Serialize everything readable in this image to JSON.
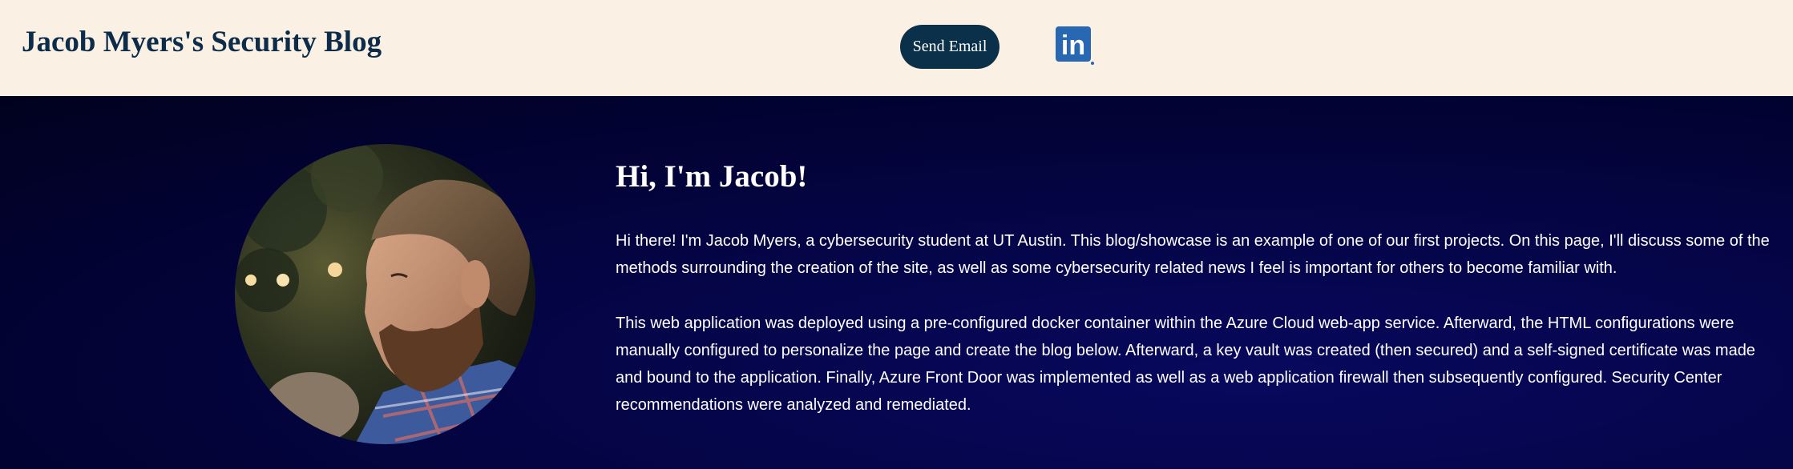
{
  "header": {
    "site_title": "Jacob Myers's Security Blog",
    "send_email_label": "Send Email",
    "linkedin_icon": "linkedin-icon",
    "linkedin_text": "in"
  },
  "hero": {
    "greeting": "Hi, I'm Jacob!",
    "paragraph_1": "Hi there! I'm Jacob Myers, a cybersecurity student at UT Austin. This blog/showcase is an example of one of our first projects. On this page, I'll discuss some of the methods surrounding the creation of the site, as well as some cybersecurity related news I feel is important for others to become familiar with.",
    "paragraph_2": "This web application was deployed using a pre-configured docker container within the Azure Cloud web-app service. Afterward, the HTML configurations were manually configured to personalize the page and create the blog below. Afterward, a key vault was created (then secured) and a self-signed certificate was made and bound to the application. Finally, Azure Front Door was implemented as well as a web application firewall then subsequently configured. Security Center recommendations were analyzed and remediated."
  },
  "colors": {
    "header_bg": "#fbf0e4",
    "title_color": "#0c2c4a",
    "button_bg": "#0b3049",
    "hero_bg": "#020230",
    "linkedin_blue": "#2867b2"
  }
}
